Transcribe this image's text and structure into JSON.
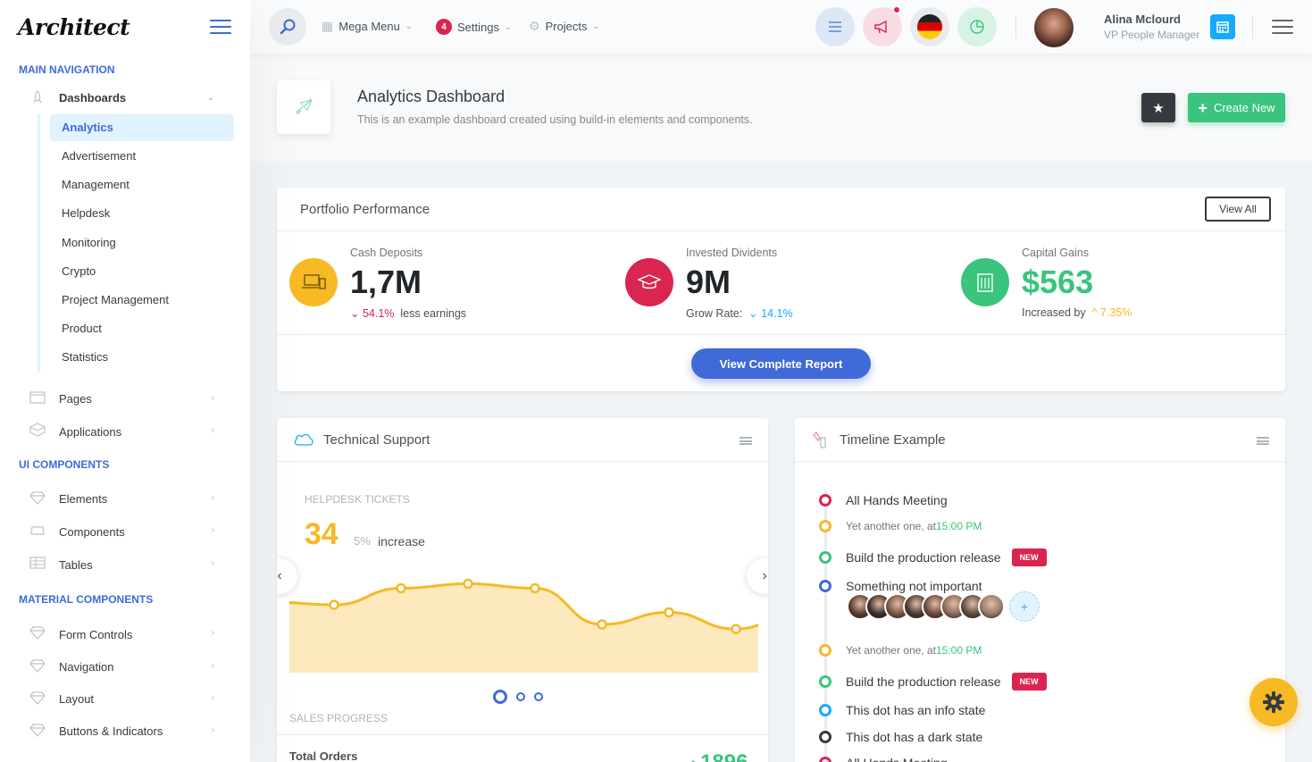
{
  "logo": "Architect",
  "sidebar": {
    "main_heading": "MAIN NAVIGATION",
    "dashboards_label": "Dashboards",
    "dashboard_items": [
      "Analytics",
      "Advertisement",
      "Management",
      "Helpdesk",
      "Monitoring",
      "Crypto",
      "Project Management",
      "Product",
      "Statistics"
    ],
    "pages_label": "Pages",
    "applications_label": "Applications",
    "ui_heading": "UI COMPONENTS",
    "ui_items": [
      "Elements",
      "Components",
      "Tables"
    ],
    "material_heading": "MATERIAL COMPONENTS",
    "material_items": [
      "Form Controls",
      "Navigation",
      "Layout",
      "Buttons & Indicators"
    ]
  },
  "header": {
    "mega_menu": "Mega Menu",
    "settings": "Settings",
    "settings_badge": "4",
    "projects": "Projects",
    "user_name": "Alina Mclourd",
    "user_role": "VP People Manager",
    "flag": "german-flag-icon"
  },
  "page_title": {
    "heading": "Analytics Dashboard",
    "subheading": "This is an example dashboard created using build-in elements and components.",
    "create_label": "Create New"
  },
  "portfolio": {
    "title": "Portfolio Performance",
    "view_all": "View All",
    "stats": [
      {
        "label": "Cash Deposits",
        "value": "1,7M",
        "change": "54.1%",
        "note": "less earnings",
        "icon_color": "#f7b924"
      },
      {
        "label": "Invested Dividents",
        "value": "9M",
        "prefix": "Grow Rate:",
        "change": "14.1%",
        "icon_color": "#d92550"
      },
      {
        "label": "Capital Gains",
        "value": "$563",
        "prefix": "Increased by",
        "change": "7.35%",
        "icon_color": "#3ac47d"
      }
    ],
    "report_button": "View Complete Report"
  },
  "tech_support": {
    "title": "Technical Support",
    "helpdesk_label": "HELPDESK TICKETS",
    "tickets": "34",
    "tickets_pct": "5%",
    "tickets_word": "increase",
    "sales_label": "SALES PROGRESS",
    "total_orders_label": "Total Orders",
    "total_orders_value": "1896"
  },
  "chart_data": {
    "type": "area",
    "title": "",
    "xlabel": "",
    "ylabel": "",
    "values": [
      47,
      45,
      56,
      59,
      56,
      32,
      40,
      29,
      42
    ],
    "ylim": [
      0,
      80
    ],
    "color": "#f7b924",
    "fill": "#fce9bd"
  },
  "timeline": {
    "title": "Timeline Example",
    "items": [
      {
        "kind": "title",
        "text": "All Hands Meeting",
        "color": "#d92550"
      },
      {
        "kind": "sub",
        "text": "Yet another one, at ",
        "time": "15:00 PM",
        "color": "#f7b924"
      },
      {
        "kind": "title",
        "text": "Build the production release",
        "badge": "NEW",
        "color": "#3ac47d"
      },
      {
        "kind": "title",
        "text": "Something not important",
        "color": "#3f6ad8"
      },
      {
        "kind": "sub",
        "text": "Yet another one, at ",
        "time": "15:00 PM",
        "color": "#f7b924"
      },
      {
        "kind": "title",
        "text": "Build the production release",
        "badge": "NEW",
        "color": "#3ac47d"
      },
      {
        "kind": "title",
        "text": "This dot has an info state",
        "color": "#16aaff"
      },
      {
        "kind": "title",
        "text": "This dot has a dark state",
        "color": "#343a40"
      },
      {
        "kind": "title",
        "text": "All Hands Meeting",
        "color": "#d92550"
      }
    ],
    "avatar_count": 8
  }
}
